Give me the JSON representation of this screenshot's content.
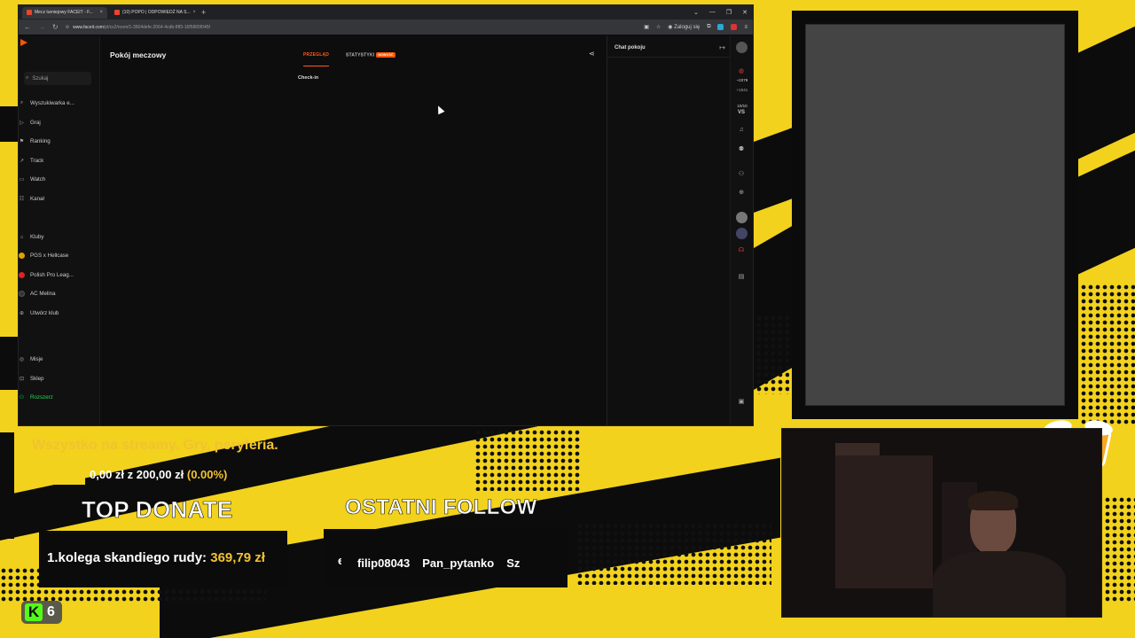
{
  "browser": {
    "tabs": [
      {
        "label": "Mecz turniejowy FACEIT - F...",
        "color": "#e8452c"
      },
      {
        "label": "(10) POPO | ODPOWIEDŹ NA S...",
        "color": "#e8452c"
      }
    ],
    "url_domain": "www.faceit.com",
    "url_path": "/pl/cs2/room/1-3504defe-2064-4cdb-8ff3-16f5865f045f",
    "login_label": "Zaloguj się"
  },
  "sidebar": {
    "search_placeholder": "Szukaj",
    "items": [
      {
        "label": "Wyszukiwarka e..."
      },
      {
        "label": "Graj"
      },
      {
        "label": "Ranking"
      },
      {
        "label": "Track"
      },
      {
        "label": "Watch"
      },
      {
        "label": "Kanał"
      }
    ],
    "clubs": [
      {
        "label": "Kluby"
      },
      {
        "label": "PGS x Hellcase"
      },
      {
        "label": "Polish Pro Leag..."
      },
      {
        "label": "AC Melina"
      },
      {
        "label": "Utwórz klub"
      }
    ],
    "bottom": [
      {
        "label": "Misje"
      },
      {
        "label": "Sklep"
      },
      {
        "label": "Rozszerz"
      }
    ]
  },
  "main": {
    "title": "Pokój meczowy",
    "tab_overview": "PRZEGLĄD",
    "tab_stats": "STATYSTYKI",
    "new_badge": "NOWOŚĆ",
    "checkin": "Check-in"
  },
  "chat": {
    "title": "Chat pokoju"
  },
  "rail": {
    "elo": "~2279",
    "elo_delta": "+1541",
    "level": "10/10",
    "vs": "VS"
  },
  "overlay": {
    "goal_title": "Wszystko na streamy. Gry, peryferia.",
    "goal_amount": "0,00 zł z 200,00 zł",
    "goal_percent": "(0.00%)",
    "top_donate_head": "TOP DONATE",
    "donate_rank": "1.",
    "donate_name": "kolega skandiego rudy:",
    "donate_amount": "369,79 zł",
    "follow_head": "OSTATNI FOLLOW",
    "follow_prefix": "e",
    "followers": [
      "filip08043",
      "Pan_pytanko",
      "Sz"
    ],
    "kick_letter": "K",
    "kick_count": "6"
  },
  "colors": {
    "accent": "#ff5500",
    "overlay_yellow": "#f2d21c",
    "gold_text": "#f2c230",
    "kick_green": "#53fc18"
  }
}
